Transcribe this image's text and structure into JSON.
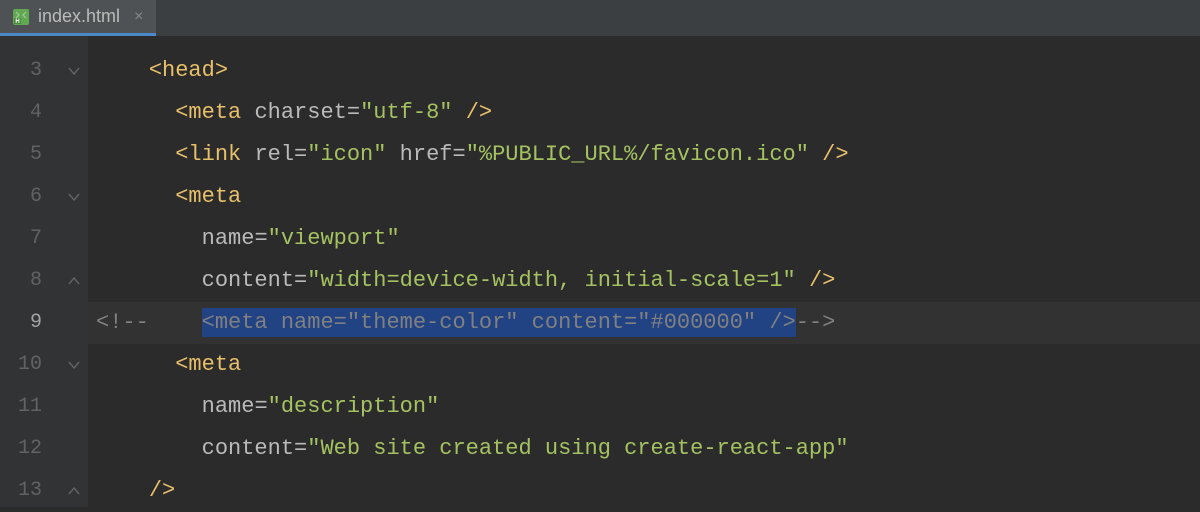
{
  "tab": {
    "filename": "index.html",
    "close_glyph": "×"
  },
  "gutter": {
    "line_numbers": [
      "3",
      "4",
      "5",
      "6",
      "7",
      "8",
      "9",
      "10",
      "11",
      "12",
      "13"
    ],
    "current_line_index": 6
  },
  "code": {
    "lines": [
      {
        "indent": "    ",
        "segments": [
          {
            "text": "<",
            "class": "tag-bracket"
          },
          {
            "text": "head",
            "class": "tag-name"
          },
          {
            "text": ">",
            "class": "tag-bracket"
          }
        ]
      },
      {
        "indent": "      ",
        "segments": [
          {
            "text": "<",
            "class": "tag-bracket"
          },
          {
            "text": "meta ",
            "class": "tag-name"
          },
          {
            "text": "charset",
            "class": "attr-name"
          },
          {
            "text": "=",
            "class": "attr-name"
          },
          {
            "text": "\"utf-8\" ",
            "class": "attr-value"
          },
          {
            "text": "/>",
            "class": "tag-bracket"
          }
        ]
      },
      {
        "indent": "      ",
        "segments": [
          {
            "text": "<",
            "class": "tag-bracket"
          },
          {
            "text": "link ",
            "class": "tag-name"
          },
          {
            "text": "rel",
            "class": "attr-name"
          },
          {
            "text": "=",
            "class": "attr-name"
          },
          {
            "text": "\"icon\" ",
            "class": "attr-value"
          },
          {
            "text": "href",
            "class": "attr-name"
          },
          {
            "text": "=",
            "class": "attr-name"
          },
          {
            "text": "\"%PUBLIC_URL%/favicon.ico\" ",
            "class": "attr-value"
          },
          {
            "text": "/>",
            "class": "tag-bracket"
          }
        ]
      },
      {
        "indent": "      ",
        "segments": [
          {
            "text": "<",
            "class": "tag-bracket"
          },
          {
            "text": "meta",
            "class": "tag-name"
          }
        ]
      },
      {
        "indent": "        ",
        "segments": [
          {
            "text": "name",
            "class": "attr-name"
          },
          {
            "text": "=",
            "class": "attr-name"
          },
          {
            "text": "\"viewport\"",
            "class": "attr-value"
          }
        ]
      },
      {
        "indent": "        ",
        "segments": [
          {
            "text": "content",
            "class": "attr-name"
          },
          {
            "text": "=",
            "class": "attr-name"
          },
          {
            "text": "\"width=device-width, initial-scale=1\" ",
            "class": "attr-value"
          },
          {
            "text": "/>",
            "class": "tag-bracket"
          }
        ]
      },
      {
        "indent": "",
        "current": true,
        "segments": [
          {
            "text": "<!--",
            "class": "comment"
          },
          {
            "text": "    ",
            "class": "comment"
          },
          {
            "text": "<meta name=\"theme-color\" content=\"#000000\" />",
            "class": "comment selection"
          },
          {
            "text": "-->",
            "class": "comment"
          }
        ]
      },
      {
        "indent": "      ",
        "segments": [
          {
            "text": "<",
            "class": "tag-bracket"
          },
          {
            "text": "meta",
            "class": "tag-name"
          }
        ]
      },
      {
        "indent": "        ",
        "segments": [
          {
            "text": "name",
            "class": "attr-name"
          },
          {
            "text": "=",
            "class": "attr-name"
          },
          {
            "text": "\"description\"",
            "class": "attr-value"
          }
        ]
      },
      {
        "indent": "        ",
        "segments": [
          {
            "text": "content",
            "class": "attr-name"
          },
          {
            "text": "=",
            "class": "attr-name"
          },
          {
            "text": "\"Web site created using create-react-app\"",
            "class": "attr-value"
          }
        ]
      },
      {
        "indent": "    ",
        "segments": [
          {
            "text": "/>",
            "class": "tag-bracket"
          }
        ]
      }
    ]
  },
  "fold_markers": [
    {
      "line": 0,
      "type": "down"
    },
    {
      "line": 3,
      "type": "down"
    },
    {
      "line": 5,
      "type": "up"
    },
    {
      "line": 7,
      "type": "down"
    },
    {
      "line": 10,
      "type": "up"
    }
  ]
}
